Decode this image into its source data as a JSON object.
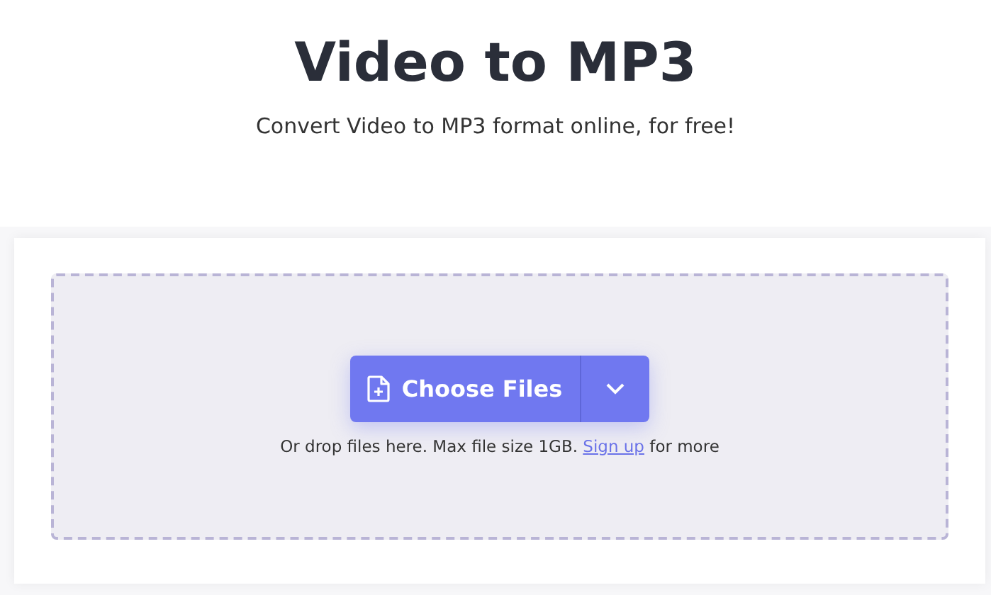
{
  "header": {
    "title": "Video to MP3",
    "subtitle": "Convert Video to MP3 format online, for free!"
  },
  "upload": {
    "button": "Choose Files",
    "hint_before": "Or drop files here. Max file size 1GB.",
    "link": "Sign up",
    "hint_after": "for more"
  }
}
